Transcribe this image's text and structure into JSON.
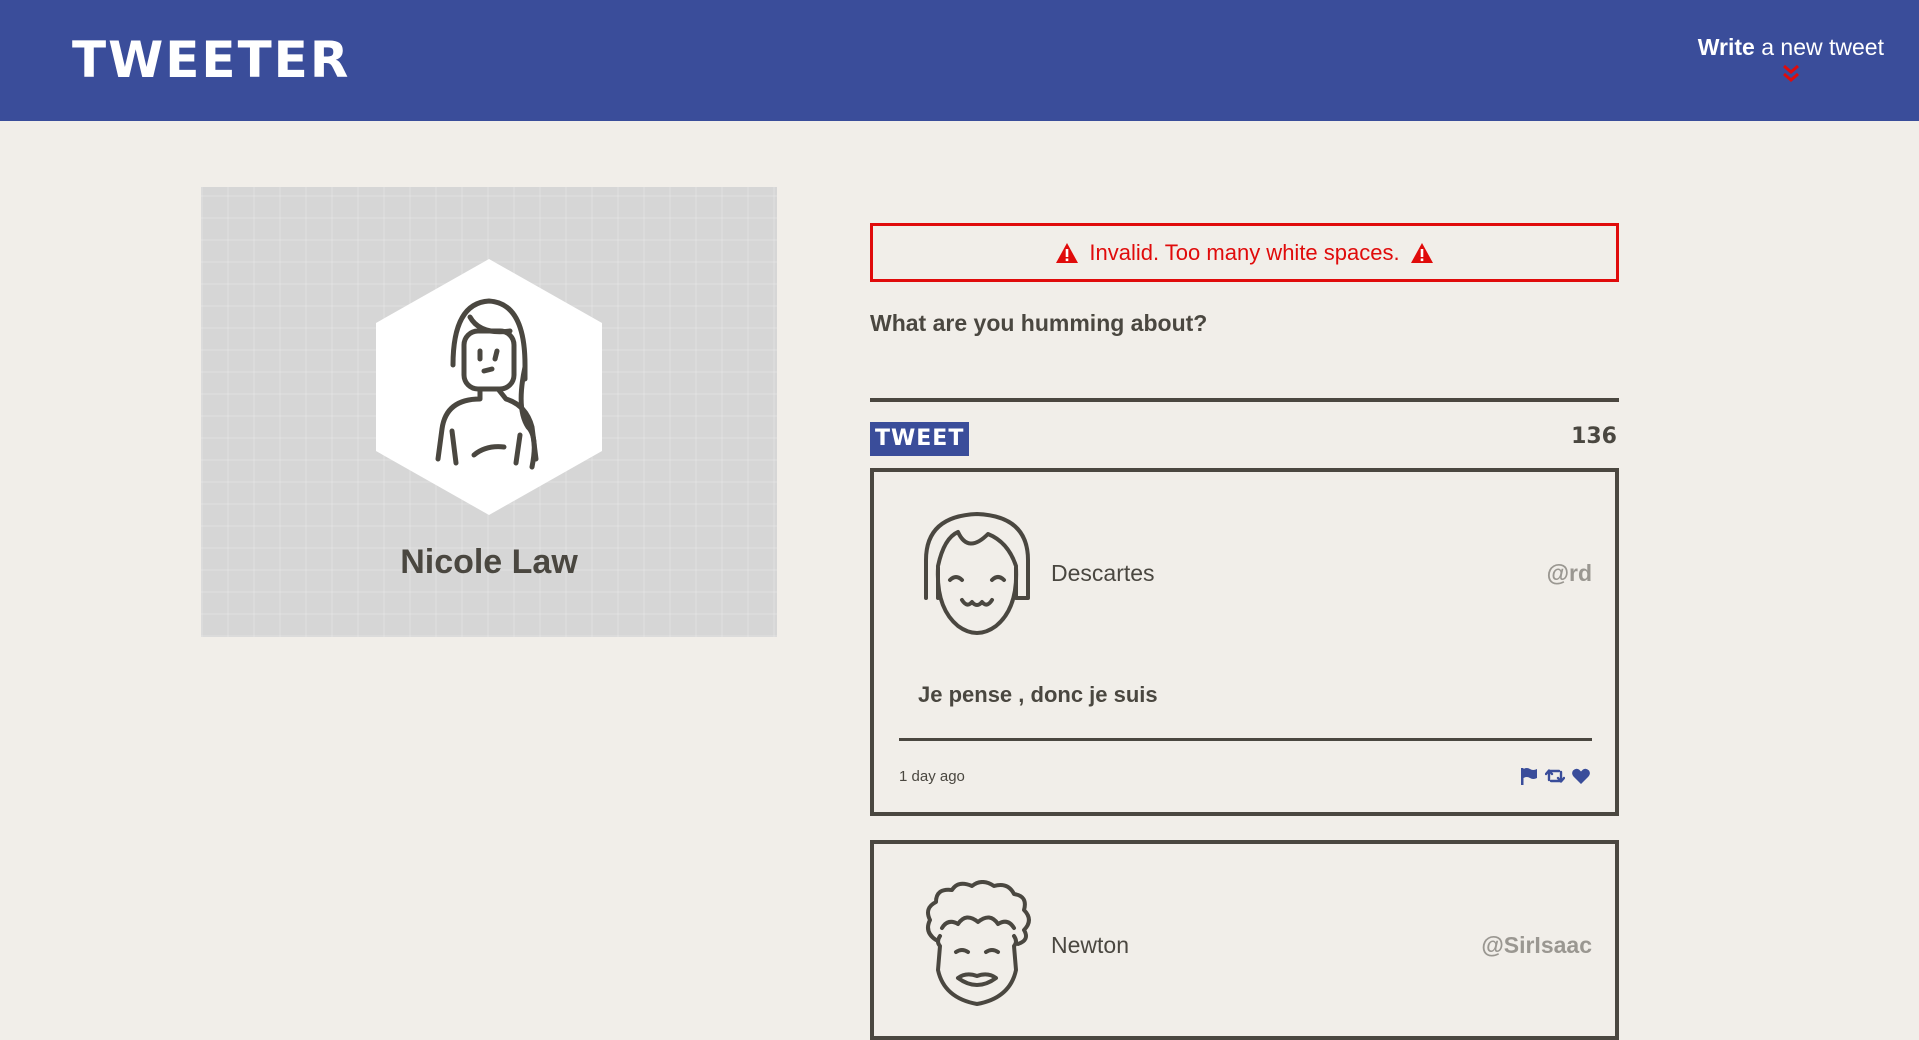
{
  "header": {
    "brand": "TWEETER",
    "compose_toggle_strong": "Write",
    "compose_toggle_rest": " a new tweet",
    "toggle_icon": "double-chevron-down-icon",
    "accent_color": "#3a4d9a",
    "toggle_icon_color": "#e00b0b"
  },
  "profile": {
    "name": "Nicole Law",
    "avatar_icon": "woman-avatar-icon"
  },
  "composer": {
    "error_message": "Invalid. Too many white spaces.",
    "error_color": "#e00b0b",
    "prompt": "What are you humming about?",
    "text_value": "",
    "submit_label": "TWEET",
    "char_counter": "136"
  },
  "tweets": [
    {
      "name": "Descartes",
      "handle": "@rd",
      "content": "Je pense , donc je suis",
      "timestamp": "1 day ago",
      "avatar_icon": "smiling-girl-avatar-icon",
      "actions": [
        "flag-icon",
        "retweet-icon",
        "heart-icon"
      ]
    },
    {
      "name": "Newton",
      "handle": "@SirIsaac",
      "avatar_icon": "curly-hair-avatar-icon"
    }
  ]
}
